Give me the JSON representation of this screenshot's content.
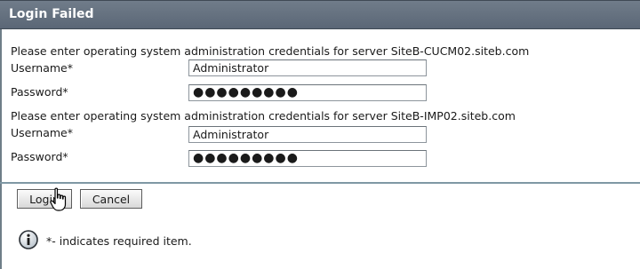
{
  "title": "Login Failed",
  "servers": [
    {
      "prompt": "Please enter operating system administration credentials for server SiteB-CUCM02.siteb.com",
      "username_label": "Username*",
      "username_value": "Administrator",
      "password_label": "Password*",
      "password_value": "●●●●●●●●●"
    },
    {
      "prompt": "Please enter operating system administration credentials for server SiteB-IMP02.siteb.com",
      "username_label": "Username*",
      "username_value": "Administrator",
      "password_label": "Password*",
      "password_value": "●●●●●●●●●"
    }
  ],
  "buttons": {
    "login": "Login",
    "cancel": "Cancel"
  },
  "note": {
    "icon": "info-icon",
    "text": "*- indicates required item."
  },
  "colors": {
    "titlebar": "#5b6776",
    "divider": "#7f98a4"
  }
}
